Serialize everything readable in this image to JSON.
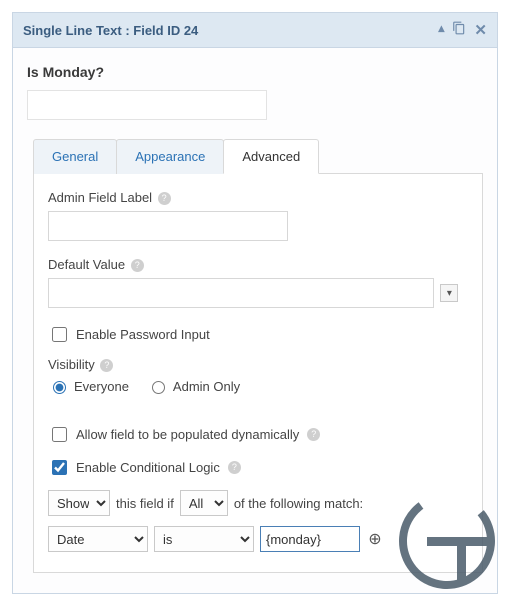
{
  "panel": {
    "title": "Single Line Text : Field ID 24"
  },
  "question": "Is Monday?",
  "tabs": {
    "general": "General",
    "appearance": "Appearance",
    "advanced": "Advanced"
  },
  "form": {
    "adminLabel": {
      "label": "Admin Field Label",
      "value": ""
    },
    "defaultValue": {
      "label": "Default Value",
      "value": ""
    },
    "passwordInput": {
      "label": "Enable Password Input",
      "checked": false
    },
    "visibility": {
      "label": "Visibility",
      "options": {
        "everyone": "Everyone",
        "adminOnly": "Admin Only"
      },
      "selected": "everyone"
    },
    "dynamicPopulate": {
      "label": "Allow field to be populated dynamically",
      "checked": false
    },
    "conditionalLogic": {
      "enableLabel": "Enable Conditional Logic",
      "checked": true,
      "action": "Show",
      "text1": "this field if",
      "match": "All",
      "text2": "of the following match:",
      "rule": {
        "field": "Date",
        "operator": "is",
        "value": "{monday}"
      }
    }
  }
}
